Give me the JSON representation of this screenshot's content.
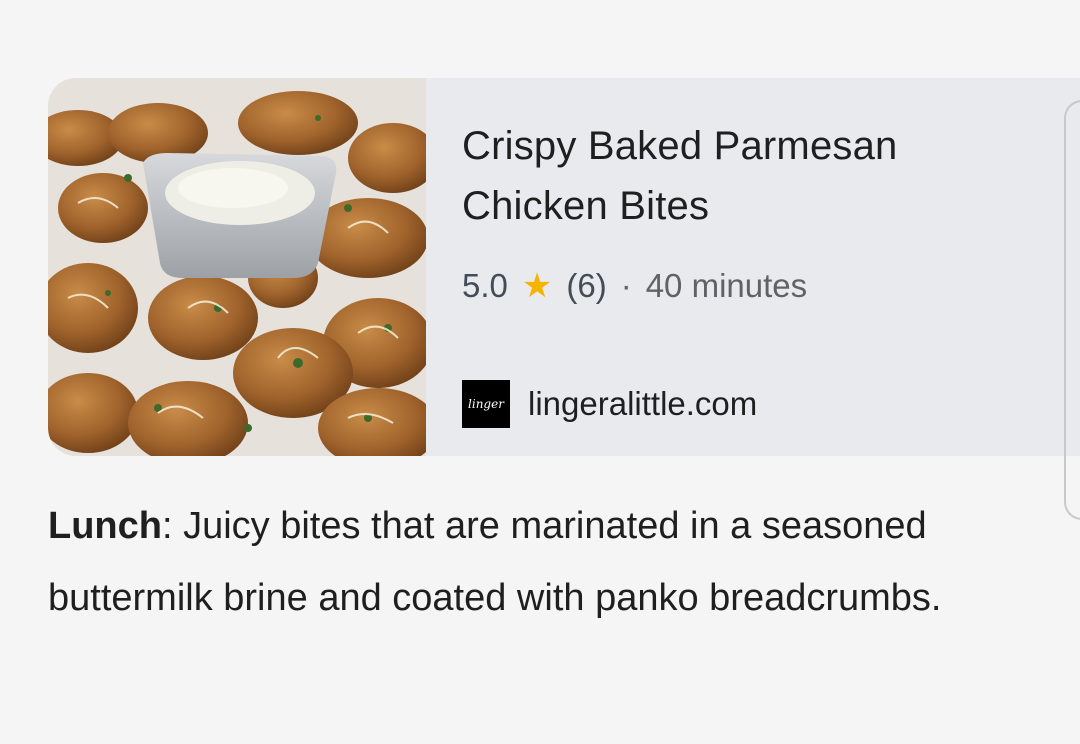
{
  "card": {
    "title": "Crispy Baked Parmesan Chicken Bites",
    "rating": "5.0",
    "star_icon": "star-icon",
    "review_count": "(6)",
    "separator": "·",
    "duration": "40 minutes",
    "source_domain": "lingeralittle.com",
    "favicon_text": "linger"
  },
  "description": {
    "label": "Lunch",
    "text": ": Juicy bites that are marinated in a seasoned buttermilk brine and coated with panko breadcrumbs."
  },
  "colors": {
    "card_bg": "#e8eaed",
    "page_bg": "#f5f5f5",
    "star": "#f4b400"
  }
}
